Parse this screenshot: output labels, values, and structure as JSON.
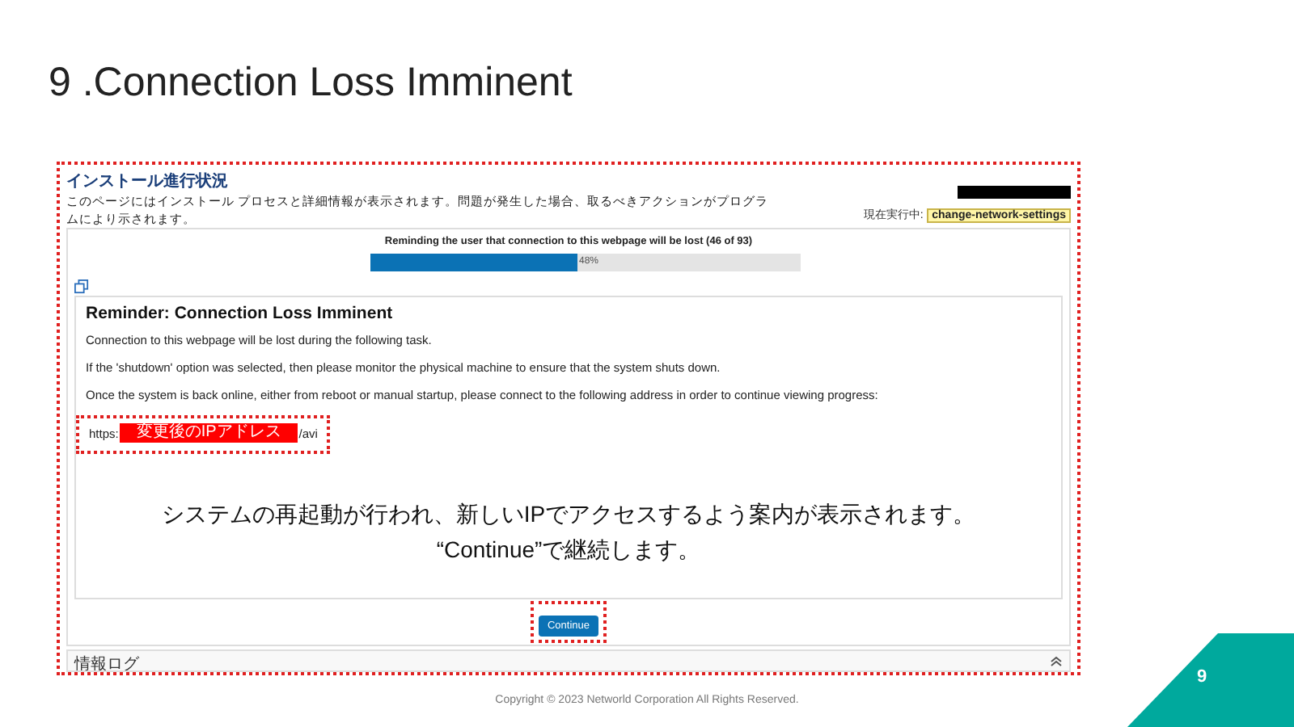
{
  "slide_title": "9 .Connection Loss Imminent",
  "screenshot": {
    "title": "インストール進行状況",
    "description": "このページにはインストール プロセスと詳細情報が表示されます。問題が発生した場合、取るべきアクションがプログラムにより示されます。",
    "current_task_label": "現在実行中:",
    "current_task": "change-network-settings",
    "progress": {
      "caption": "Reminding the user that connection to this webpage will be lost (46 of 93)",
      "level": 0.48,
      "percent": "48%"
    },
    "dialog": {
      "heading": "Reminder: Connection Loss Imminent",
      "paragraphs": [
        "Connection to this webpage will be lost during the following task.",
        "If the 'shutdown' option was selected, then please monitor the physical machine to ensure that the system shuts down.",
        "Once the system is back online, either from reboot or manual startup, please connect to the following address in order to continue viewing progress:"
      ],
      "url_prefix": "https:",
      "ip_label": "変更後のIPアドレス",
      "url_suffix": "/avi"
    },
    "annotation": [
      "システムの再起動が行われ、新しいIPでアクセスするよう案内が表示されます。",
      "“Continue”で継続します。"
    ],
    "button": "Continue",
    "info_log": "情報ログ"
  },
  "copyright": "Copyright © 2023 Networld Corporation All Rights Reserved.",
  "page_number": "9"
}
